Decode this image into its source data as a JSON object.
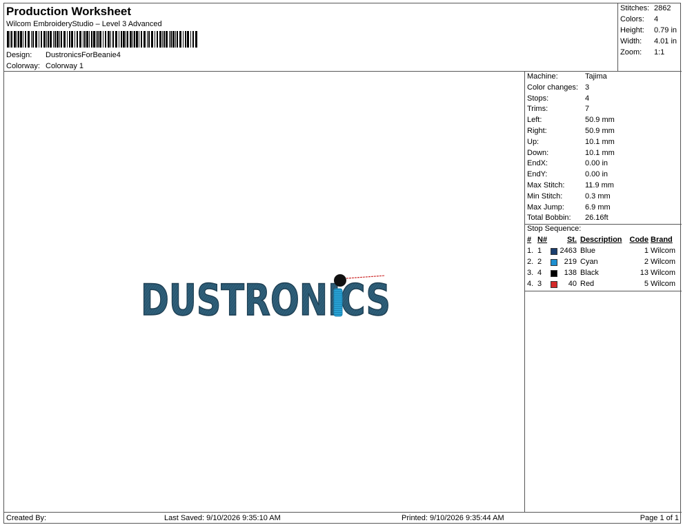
{
  "header": {
    "title": "Production Worksheet",
    "software": "Wilcom EmbroideryStudio – Level 3 Advanced",
    "design_label": "Design:",
    "design_value": "DustronicsForBeanie4",
    "colorway_label": "Colorway:",
    "colorway_value": "Colorway 1"
  },
  "summary": {
    "stitches_label": "Stitches:",
    "stitches_value": "2862",
    "colors_label": "Colors:",
    "colors_value": "4",
    "height_label": "Height:",
    "height_value": "0.79 in",
    "width_label": "Width:",
    "width_value": "4.01 in",
    "zoom_label": "Zoom:",
    "zoom_value": "1:1"
  },
  "design_art": {
    "text": "DUSTRONICS",
    "colors": {
      "blue": "#2e5f7a",
      "cyan": "#29a3d6",
      "black": "#111111",
      "red": "#cc2a2a"
    }
  },
  "machine_info": [
    {
      "label": "Machine:",
      "value": "Tajima"
    },
    {
      "label": "Color changes:",
      "value": "3"
    },
    {
      "label": "Stops:",
      "value": "4"
    },
    {
      "label": "Trims:",
      "value": "7"
    },
    {
      "label": "Left:",
      "value": "50.9 mm"
    },
    {
      "label": "Right:",
      "value": "50.9 mm"
    },
    {
      "label": "Up:",
      "value": "10.1 mm"
    },
    {
      "label": "Down:",
      "value": "10.1 mm"
    },
    {
      "label": "EndX:",
      "value": "0.00 in"
    },
    {
      "label": "EndY:",
      "value": "0.00 in"
    },
    {
      "label": "Max Stitch:",
      "value": "11.9 mm"
    },
    {
      "label": "Min Stitch:",
      "value": "0.3 mm"
    },
    {
      "label": "Max Jump:",
      "value": "6.9 mm"
    },
    {
      "label": "Total Bobbin:",
      "value": "26.16ft"
    }
  ],
  "stop_sequence": {
    "title": "Stop Sequence:",
    "columns": {
      "num": "#",
      "n": "N#",
      "st": "St.",
      "desc": "Description",
      "code": "Code",
      "brand": "Brand"
    },
    "rows": [
      {
        "num": "1.",
        "n": "1",
        "color": "#1c3f6e",
        "st": "2463",
        "desc": "Blue",
        "code": "1",
        "brand": "Wilcom"
      },
      {
        "num": "2.",
        "n": "2",
        "color": "#1e8fd0",
        "st": "219",
        "desc": "Cyan",
        "code": "2",
        "brand": "Wilcom"
      },
      {
        "num": "3.",
        "n": "4",
        "color": "#000000",
        "st": "138",
        "desc": "Black",
        "code": "13",
        "brand": "Wilcom"
      },
      {
        "num": "4.",
        "n": "3",
        "color": "#d42a2a",
        "st": "40",
        "desc": "Red",
        "code": "5",
        "brand": "Wilcom"
      }
    ]
  },
  "footer": {
    "created": "Created By:",
    "saved": "Last Saved: 9/10/2026 9:35:10 AM",
    "printed": "Printed: 9/10/2026 9:35:44 AM",
    "page": "Page 1 of 1"
  }
}
